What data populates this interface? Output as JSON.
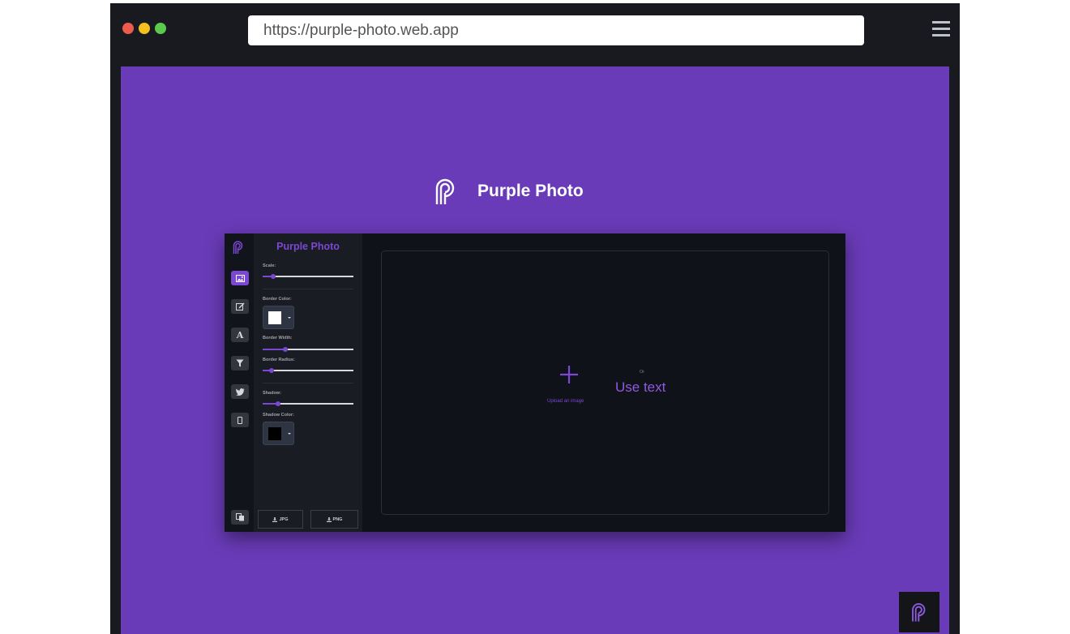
{
  "browser": {
    "url": "https://purple-photo.web.app",
    "traffic_colors": [
      "#ec5b4d",
      "#f4c01f",
      "#5bc94b"
    ]
  },
  "page": {
    "brand_title": "Purple Photo",
    "background": "#6a3bb8"
  },
  "app": {
    "panel_title": "Purple Photo",
    "accent": "#7a48d3",
    "rail": {
      "items": [
        {
          "name": "image-icon",
          "active": true
        },
        {
          "name": "edit-icon",
          "active": false
        },
        {
          "name": "text-icon",
          "glyph": "A",
          "active": false
        },
        {
          "name": "filter-icon",
          "active": false
        },
        {
          "name": "twitter-icon",
          "active": false
        },
        {
          "name": "mobile-icon",
          "active": false
        }
      ],
      "bottom": "copy-icon"
    },
    "controls": {
      "scale_label": "Scale:",
      "scale_value": 0.12,
      "border_color_label": "Border Color:",
      "border_color": "#ffffff",
      "border_width_label": "Border Width:",
      "border_width_value": 0.25,
      "border_radius_label": "Border Radius:",
      "border_radius_value": 0.1,
      "shadow_label": "Shadow:",
      "shadow_value": 0.17,
      "shadow_color_label": "Shadow Color:",
      "shadow_color": "#000000"
    },
    "downloads": {
      "jpg_label": "JPG",
      "png_label": "PNG"
    },
    "canvas": {
      "upload_label": "Upload an image",
      "or_label": "Or",
      "use_text_label": "Use text"
    }
  }
}
